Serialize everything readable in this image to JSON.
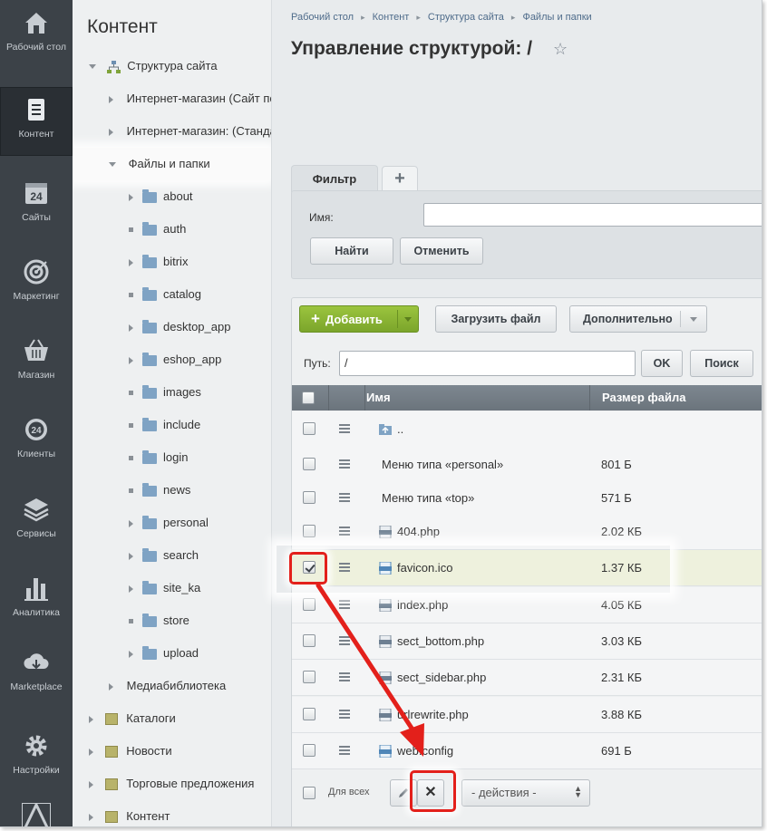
{
  "menu": [
    {
      "label": "Рабочий стол",
      "icon": "home-icon"
    },
    {
      "label": "Контент",
      "icon": "document-icon",
      "active": true
    },
    {
      "label": "Сайты",
      "icon": "calendar-24-icon"
    },
    {
      "label": "Маркетинг",
      "icon": "target-icon"
    },
    {
      "label": "Магазин",
      "icon": "basket-icon"
    },
    {
      "label": "Клиенты",
      "icon": "clients-24-icon"
    },
    {
      "label": "Сервисы",
      "icon": "layers-icon"
    },
    {
      "label": "Аналитика",
      "icon": "bar-chart-icon"
    },
    {
      "label": "Marketplace",
      "icon": "cloud-download-icon"
    },
    {
      "label": "Настройки",
      "icon": "gear-icon"
    }
  ],
  "tree": {
    "title": "Контент",
    "site_structure": "Структура сайта",
    "shop1": "Интернет-магазин (Сайт по",
    "shop2": "Интернет-магазин: (Станда",
    "files": "Файлы и папки",
    "folders": [
      "about",
      "auth",
      "bitrix",
      "catalog",
      "desktop_app",
      "eshop_app",
      "images",
      "include",
      "login",
      "news",
      "personal",
      "search",
      "site_ka",
      "store",
      "upload"
    ],
    "media": "Медиабиблиотека",
    "catalogs": "Каталоги",
    "news": "Новости",
    "offers": "Торговые предложения",
    "content": "Контент"
  },
  "breadcrumbs": [
    "Рабочий стол",
    "Контент",
    "Структура сайта",
    "Файлы и папки"
  ],
  "page_title": "Управление структурой: /",
  "filter": {
    "tab": "Фильтр",
    "add_tab": "+",
    "name_label": "Имя:",
    "name_value": "",
    "find": "Найти",
    "cancel": "Отменить"
  },
  "toolbar": {
    "add": "Добавить",
    "upload": "Загрузить файл",
    "more": "Дополнительно"
  },
  "path": {
    "label": "Путь:",
    "value": "/",
    "ok": "OK",
    "search": "Поиск"
  },
  "table": {
    "col_name": "Имя",
    "col_size": "Размер файла",
    "rows": [
      {
        "name": "..",
        "size": "",
        "icon": "folder-up-icon"
      },
      {
        "name": "Меню типа «personal»",
        "size": "801 Б",
        "icon": ""
      },
      {
        "name": "Меню типа «top»",
        "size": "571 Б",
        "icon": ""
      },
      {
        "name": "404.php",
        "size": "2.02 КБ",
        "icon": "php-file-icon"
      },
      {
        "name": "favicon.ico",
        "size": "1.37 КБ",
        "icon": "file-icon",
        "selected": true
      },
      {
        "name": "index.php",
        "size": "4.05 КБ",
        "icon": "php-file-icon"
      },
      {
        "name": "sect_bottom.php",
        "size": "3.03 КБ",
        "icon": "php-file-icon"
      },
      {
        "name": "sect_sidebar.php",
        "size": "2.31 КБ",
        "icon": "php-file-icon"
      },
      {
        "name": "urlrewrite.php",
        "size": "3.88 КБ",
        "icon": "php-file-icon"
      },
      {
        "name": "web.config",
        "size": "691 Б",
        "icon": "file-icon"
      }
    ]
  },
  "footer": {
    "for_all": "Для всех",
    "delete": "✕",
    "actions": "- действия -"
  },
  "colors": {
    "menu_bg": "#3c4248",
    "add_button": "#8bb434",
    "highlight": "#e3201b",
    "selected_row": "#eef1dd"
  }
}
